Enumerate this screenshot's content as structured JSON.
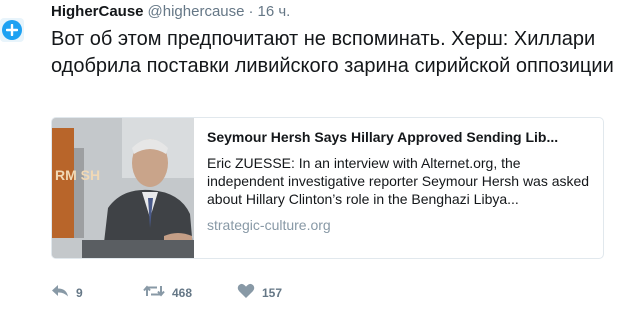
{
  "tweet": {
    "author_name": "HigherCause",
    "handle": "@highercause",
    "separator": "·",
    "time": "16 ч.",
    "text": "Вот об этом предпочитают не вспоминать. Херш: Хиллари одобрила поставки ливийского зарина сирийской оппозиции"
  },
  "card": {
    "title": "Seymour Hersh Says Hillary Approved Sending Lib...",
    "description": "Eric ZUESSE: In an interview with Alternet.org, the independent investigative reporter Seymour Hersh was asked about Hillary Clinton’s role in the Benghazi Libya...",
    "domain": "strategic-culture.org",
    "image_sign_text": "RM SH"
  },
  "actions": {
    "reply": {
      "icon": "reply-icon",
      "count": "9"
    },
    "retweet": {
      "icon": "retweet-icon",
      "count": "468"
    },
    "like": {
      "icon": "heart-icon",
      "count": "157"
    }
  },
  "colors": {
    "accent": "#1da1f2",
    "text": "#14171a",
    "secondary": "#657786",
    "domain": "#8899a6",
    "border": "#e1e8ed"
  }
}
